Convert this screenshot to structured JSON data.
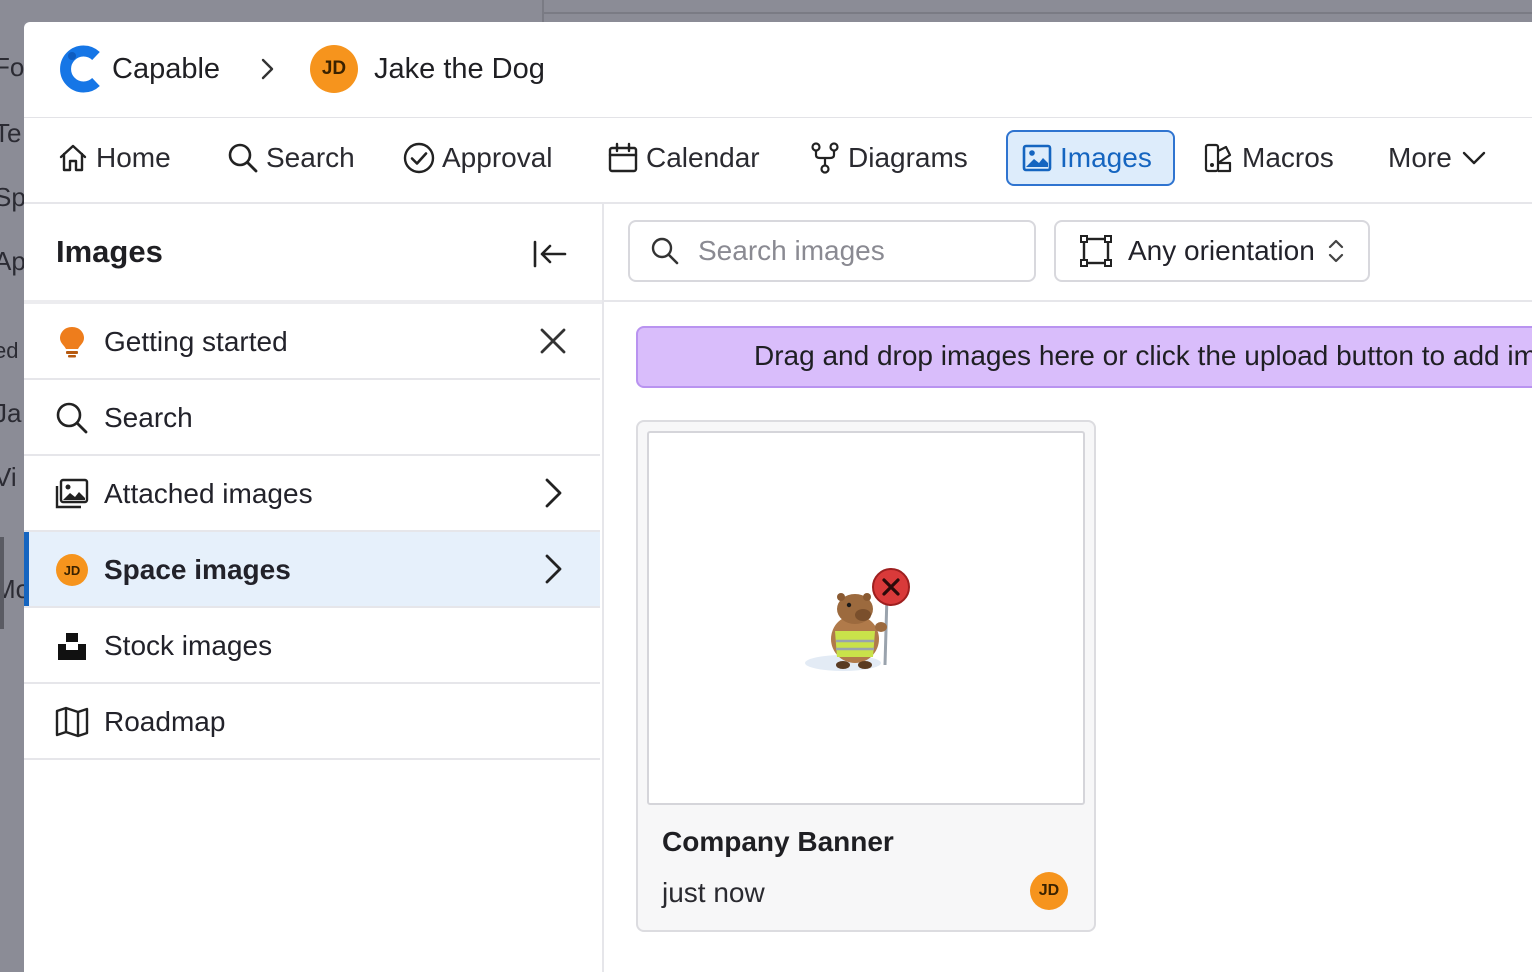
{
  "background": {
    "words": [
      "Fo",
      "Te",
      "Sp",
      "Ap",
      "ed",
      "Ja",
      "Vi",
      "Mo"
    ]
  },
  "header": {
    "brand": "Capable",
    "space_initials": "JD",
    "space_name": "Jake the Dog"
  },
  "nav": {
    "items": [
      {
        "label": "Home",
        "icon": "home-icon"
      },
      {
        "label": "Search",
        "icon": "search-icon"
      },
      {
        "label": "Approval",
        "icon": "check-circle-icon"
      },
      {
        "label": "Calendar",
        "icon": "calendar-icon"
      },
      {
        "label": "Diagrams",
        "icon": "diagram-icon"
      },
      {
        "label": "Images",
        "icon": "image-icon"
      },
      {
        "label": "Macros",
        "icon": "macros-icon"
      },
      {
        "label": "More",
        "icon": "chevron-down-icon"
      }
    ],
    "active": "Images"
  },
  "sidebar": {
    "title": "Images",
    "items": [
      {
        "label": "Getting started",
        "icon": "lightbulb-icon"
      },
      {
        "label": "Search",
        "icon": "search-icon"
      },
      {
        "label": "Attached images",
        "icon": "images-icon"
      },
      {
        "label": "Space images",
        "icon": "avatar",
        "initials": "JD"
      },
      {
        "label": "Stock images",
        "icon": "unsplash-icon"
      },
      {
        "label": "Roadmap",
        "icon": "map-icon"
      }
    ],
    "selected": "Space images"
  },
  "toolbar": {
    "search_placeholder": "Search images",
    "orientation_label": "Any orientation"
  },
  "dropzone": {
    "text": "Drag and drop images here or click the upload button to add images"
  },
  "images": [
    {
      "title": "Company Banner",
      "meta": "just now",
      "uploader_initials": "JD"
    }
  ],
  "colors": {
    "accent": "#1565c0",
    "active_bg": "#ddecfb",
    "dropzone_bg": "#d9bdfb",
    "avatar": "#f6941d"
  }
}
